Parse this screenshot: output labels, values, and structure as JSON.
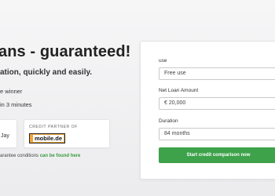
{
  "hero": {
    "headline": "ans - guaranteed!",
    "subline": "ation, quickly and easily.",
    "bullets": [
      "e winner",
      "in 3 minutes"
    ]
  },
  "badges": {
    "left_card_text": "Jay",
    "partner_label": "CREDIT PARTNER OF",
    "partner_logo_text": "mobile.de"
  },
  "footnote": {
    "text": "arantee conditions ",
    "link": "can be found here"
  },
  "form": {
    "purpose": {
      "label": "use",
      "value": "Free use"
    },
    "amount": {
      "label": "Net Loan Amount",
      "value": "€ 20,000"
    },
    "duration": {
      "label": "Duration",
      "value": "84 months"
    },
    "submit_label": "Start credit comparison now"
  },
  "colors": {
    "accent": "#3da24a",
    "link": "#3a9a3f",
    "logo_orange": "#f1a53b"
  }
}
